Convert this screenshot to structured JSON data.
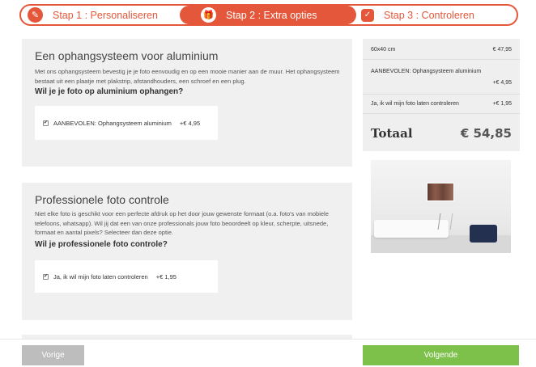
{
  "stepper": {
    "steps": [
      {
        "label": "Stap 1 : Personaliseren",
        "icon": "pencil-icon"
      },
      {
        "label": "Stap 2 : Extra opties",
        "icon": "gift-icon"
      },
      {
        "label": "Stap 3 : Controleren",
        "icon": "checklist-icon"
      }
    ],
    "accent": "#e4573a"
  },
  "options": [
    {
      "title": "Een ophangsysteem voor aluminium",
      "description": "Met ons ophangsysteem bevestig je je foto eenvoudig en op een mooie manier aan de muur. Het ophangsysteem bestaat uit een plaatje met plakstrip, afstandhouders, een schroef en een plug.",
      "question": "Wil je je foto op aluminium ophangen?",
      "choice_label": "AANBEVOLEN: Ophangsysteem aluminium",
      "choice_price": "+€ 4,95",
      "checked": true
    },
    {
      "title": "Professionele foto controle",
      "description": "Niet elke foto is geschikt voor een perfecte afdruk op het door jouw gewenste formaat (o.a. foto's van mobiele telefoons, whatsapp). Wil jij dat een van onze professionals jouw foto beoordeelt op kleur, scherpte, uitsnede, formaat en aantal pixels? Selecteer dan deze optie.",
      "question": "Wil je professionele foto controle?",
      "choice_label": "Ja, ik wil mijn foto laten controleren",
      "choice_price": "+€ 1,95",
      "checked": true
    }
  ],
  "summary": {
    "rows": [
      {
        "label": "60x40 cm",
        "value": "€ 47,95"
      },
      {
        "label": "AANBEVOLEN: Ophangsysteem aluminium",
        "value": "+€ 4,95"
      },
      {
        "label": "Ja, ik wil mijn foto laten controleren",
        "value": "+€ 1,95"
      }
    ],
    "total_label": "Totaal",
    "total_value": "€ 54,85"
  },
  "footer": {
    "prev_label": "Vorige",
    "next_label": "Volgende",
    "next_color": "#7dc04a",
    "prev_color": "#bdbdbd"
  }
}
